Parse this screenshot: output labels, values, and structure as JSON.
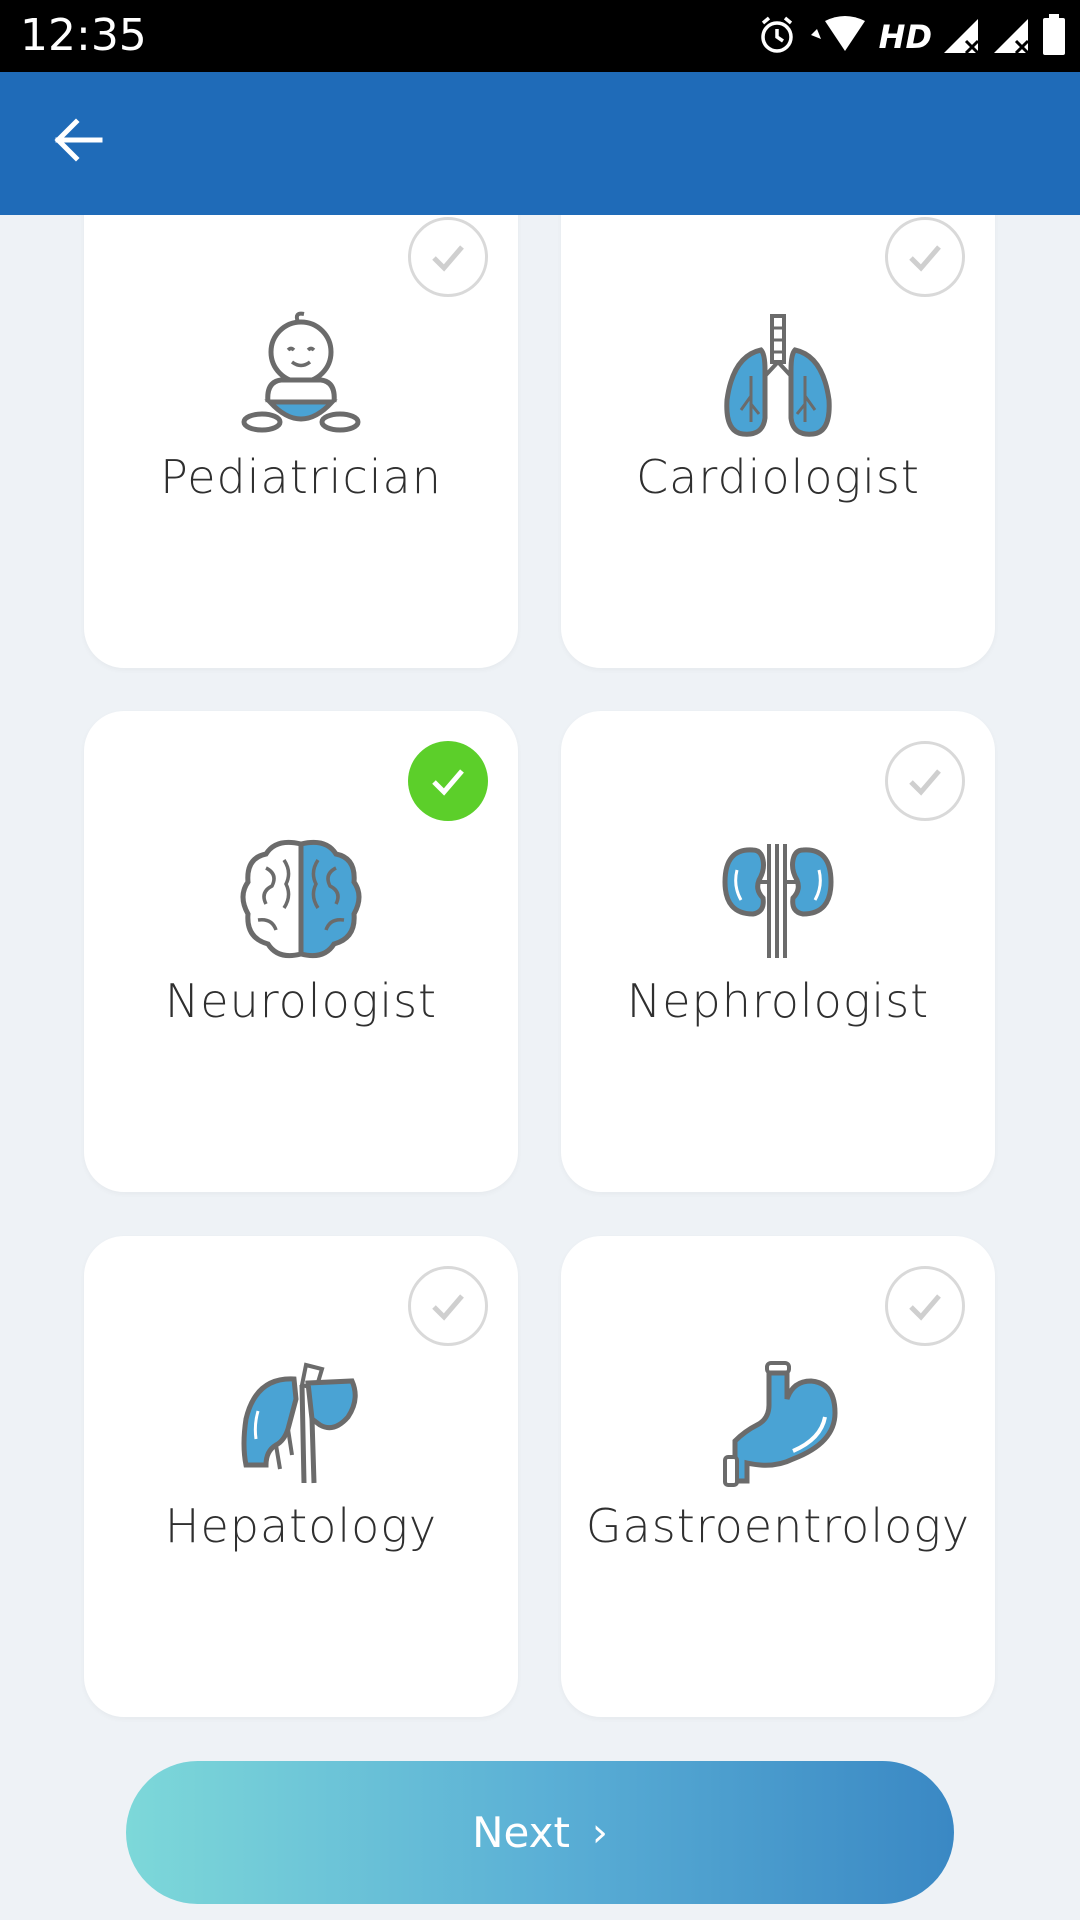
{
  "status_bar": {
    "time": "12:35",
    "network": "HD",
    "icons": [
      "alarm-icon",
      "wifi-icon",
      "signal-icon",
      "signal-icon",
      "battery-icon"
    ]
  },
  "app_bar": {
    "back_icon": "arrow-left-icon",
    "color": "#1f6bb8"
  },
  "specialties": [
    {
      "label": "Pediatrician",
      "icon": "baby-icon",
      "selected": false
    },
    {
      "label": "Cardiologist",
      "icon": "lungs-icon",
      "selected": false
    },
    {
      "label": "Neurologist",
      "icon": "brain-icon",
      "selected": true
    },
    {
      "label": "Nephrologist",
      "icon": "kidneys-icon",
      "selected": false
    },
    {
      "label": "Hepatology",
      "icon": "liver-icon",
      "selected": false
    },
    {
      "label": "Gastroentrology",
      "icon": "stomach-icon",
      "selected": false
    }
  ],
  "next_button": {
    "label": "Next",
    "chevron": "›"
  },
  "colors": {
    "selected_check": "#5ccf2a",
    "organ_blue": "#4aa3d4"
  }
}
